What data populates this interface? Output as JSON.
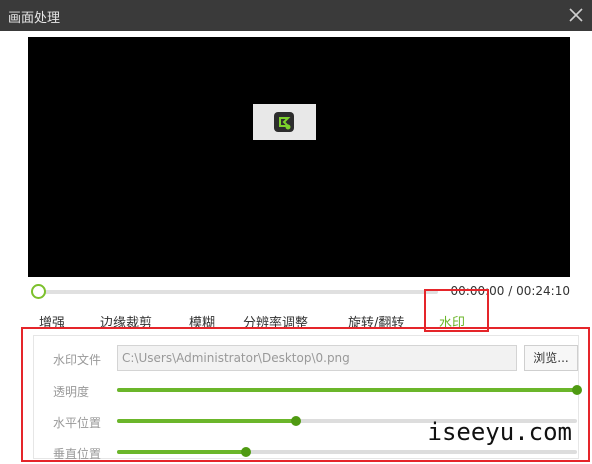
{
  "window": {
    "title": "画面处理"
  },
  "player": {
    "time_display": "00:00:00 / 00:24:10",
    "progress": 0.0
  },
  "tabs": [
    {
      "label": "增强"
    },
    {
      "label": "边缘裁剪"
    },
    {
      "label": "模糊"
    },
    {
      "label": "分辨率调整"
    },
    {
      "label": "旋转/翻转"
    },
    {
      "label": "水印"
    }
  ],
  "watermark": {
    "file_label": "水印文件",
    "file_value": "C:\\Users\\Administrator\\Desktop\\0.png",
    "browse_label": "浏览...",
    "opacity_label": "透明度",
    "opacity_value": 1.0,
    "hpos_label": "水平位置",
    "hpos_value": 0.39,
    "vpos_label": "垂直位置",
    "vpos_value": 0.28
  },
  "site_watermark": "iseeyu.com",
  "colors": {
    "accent": "#6bb62a",
    "highlight": "#e5252a",
    "titlebar": "#3a3a3a"
  }
}
